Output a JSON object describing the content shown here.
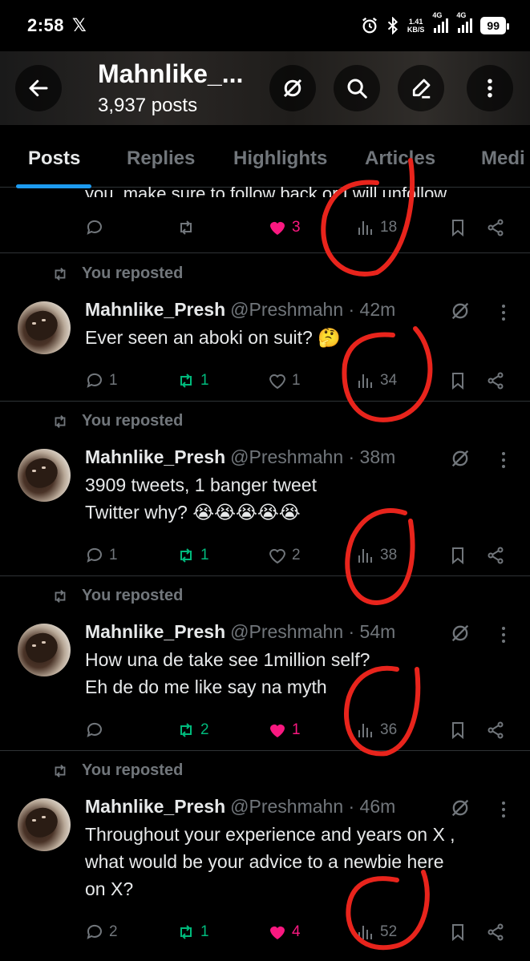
{
  "status_bar": {
    "time": "2:58",
    "x_logo": "𝕏",
    "net_speed_value": "1.41",
    "net_speed_unit": "KB/S",
    "sig1_label": "4G",
    "sig2_label": "4G",
    "battery": "99"
  },
  "header": {
    "title": "Mahnlike_...",
    "subtitle": "3,937 posts",
    "icons": [
      "back-arrow-icon",
      "grok-icon",
      "search-icon",
      "compose-icon",
      "more-vertical-icon"
    ]
  },
  "tabs": [
    {
      "label": "Posts",
      "active": true
    },
    {
      "label": "Replies",
      "active": false
    },
    {
      "label": "Highlights",
      "active": false
    },
    {
      "label": "Articles",
      "active": false
    },
    {
      "label": "Medi",
      "active": false
    }
  ],
  "partial_post": {
    "text": "you, make sure to follow back or I will unfollow",
    "replies": "",
    "reposts": "",
    "likes": "3",
    "views": "18"
  },
  "posts": [
    {
      "repost_label": "You reposted",
      "name": "Mahnlike_Presh",
      "handle_time": "@Preshmahn · 42m",
      "text": "Ever seen an aboki on suit? 🤔",
      "replies": "1",
      "reposts": "1",
      "likes": "1",
      "views": "34",
      "liked": false
    },
    {
      "repost_label": "You reposted",
      "name": "Mahnlike_Presh",
      "handle_time": "@Preshmahn · 38m",
      "text": "3909 tweets, 1 banger tweet\nTwitter why? 😭😭😭😭😭",
      "replies": "1",
      "reposts": "1",
      "likes": "2",
      "views": "38",
      "liked": false
    },
    {
      "repost_label": "You reposted",
      "name": "Mahnlike_Presh",
      "handle_time": "@Preshmahn · 54m",
      "text": "How una de take see 1million self?\nEh de do me like say na myth",
      "replies": "",
      "reposts": "2",
      "likes": "1",
      "views": "36",
      "liked": true
    },
    {
      "repost_label": "You reposted",
      "name": "Mahnlike_Presh",
      "handle_time": "@Preshmahn · 46m",
      "text": "Throughout your experience and years on X ,\nwhat would be your advice to a newbie here\non X?",
      "replies": "2",
      "reposts": "1",
      "likes": "4",
      "views": "52",
      "liked": true
    }
  ],
  "colors": {
    "accent": "#1d9bf0",
    "like": "#f91880",
    "repost": "#00ba7c",
    "muted": "#71767b",
    "annotation": "#e8241c"
  }
}
